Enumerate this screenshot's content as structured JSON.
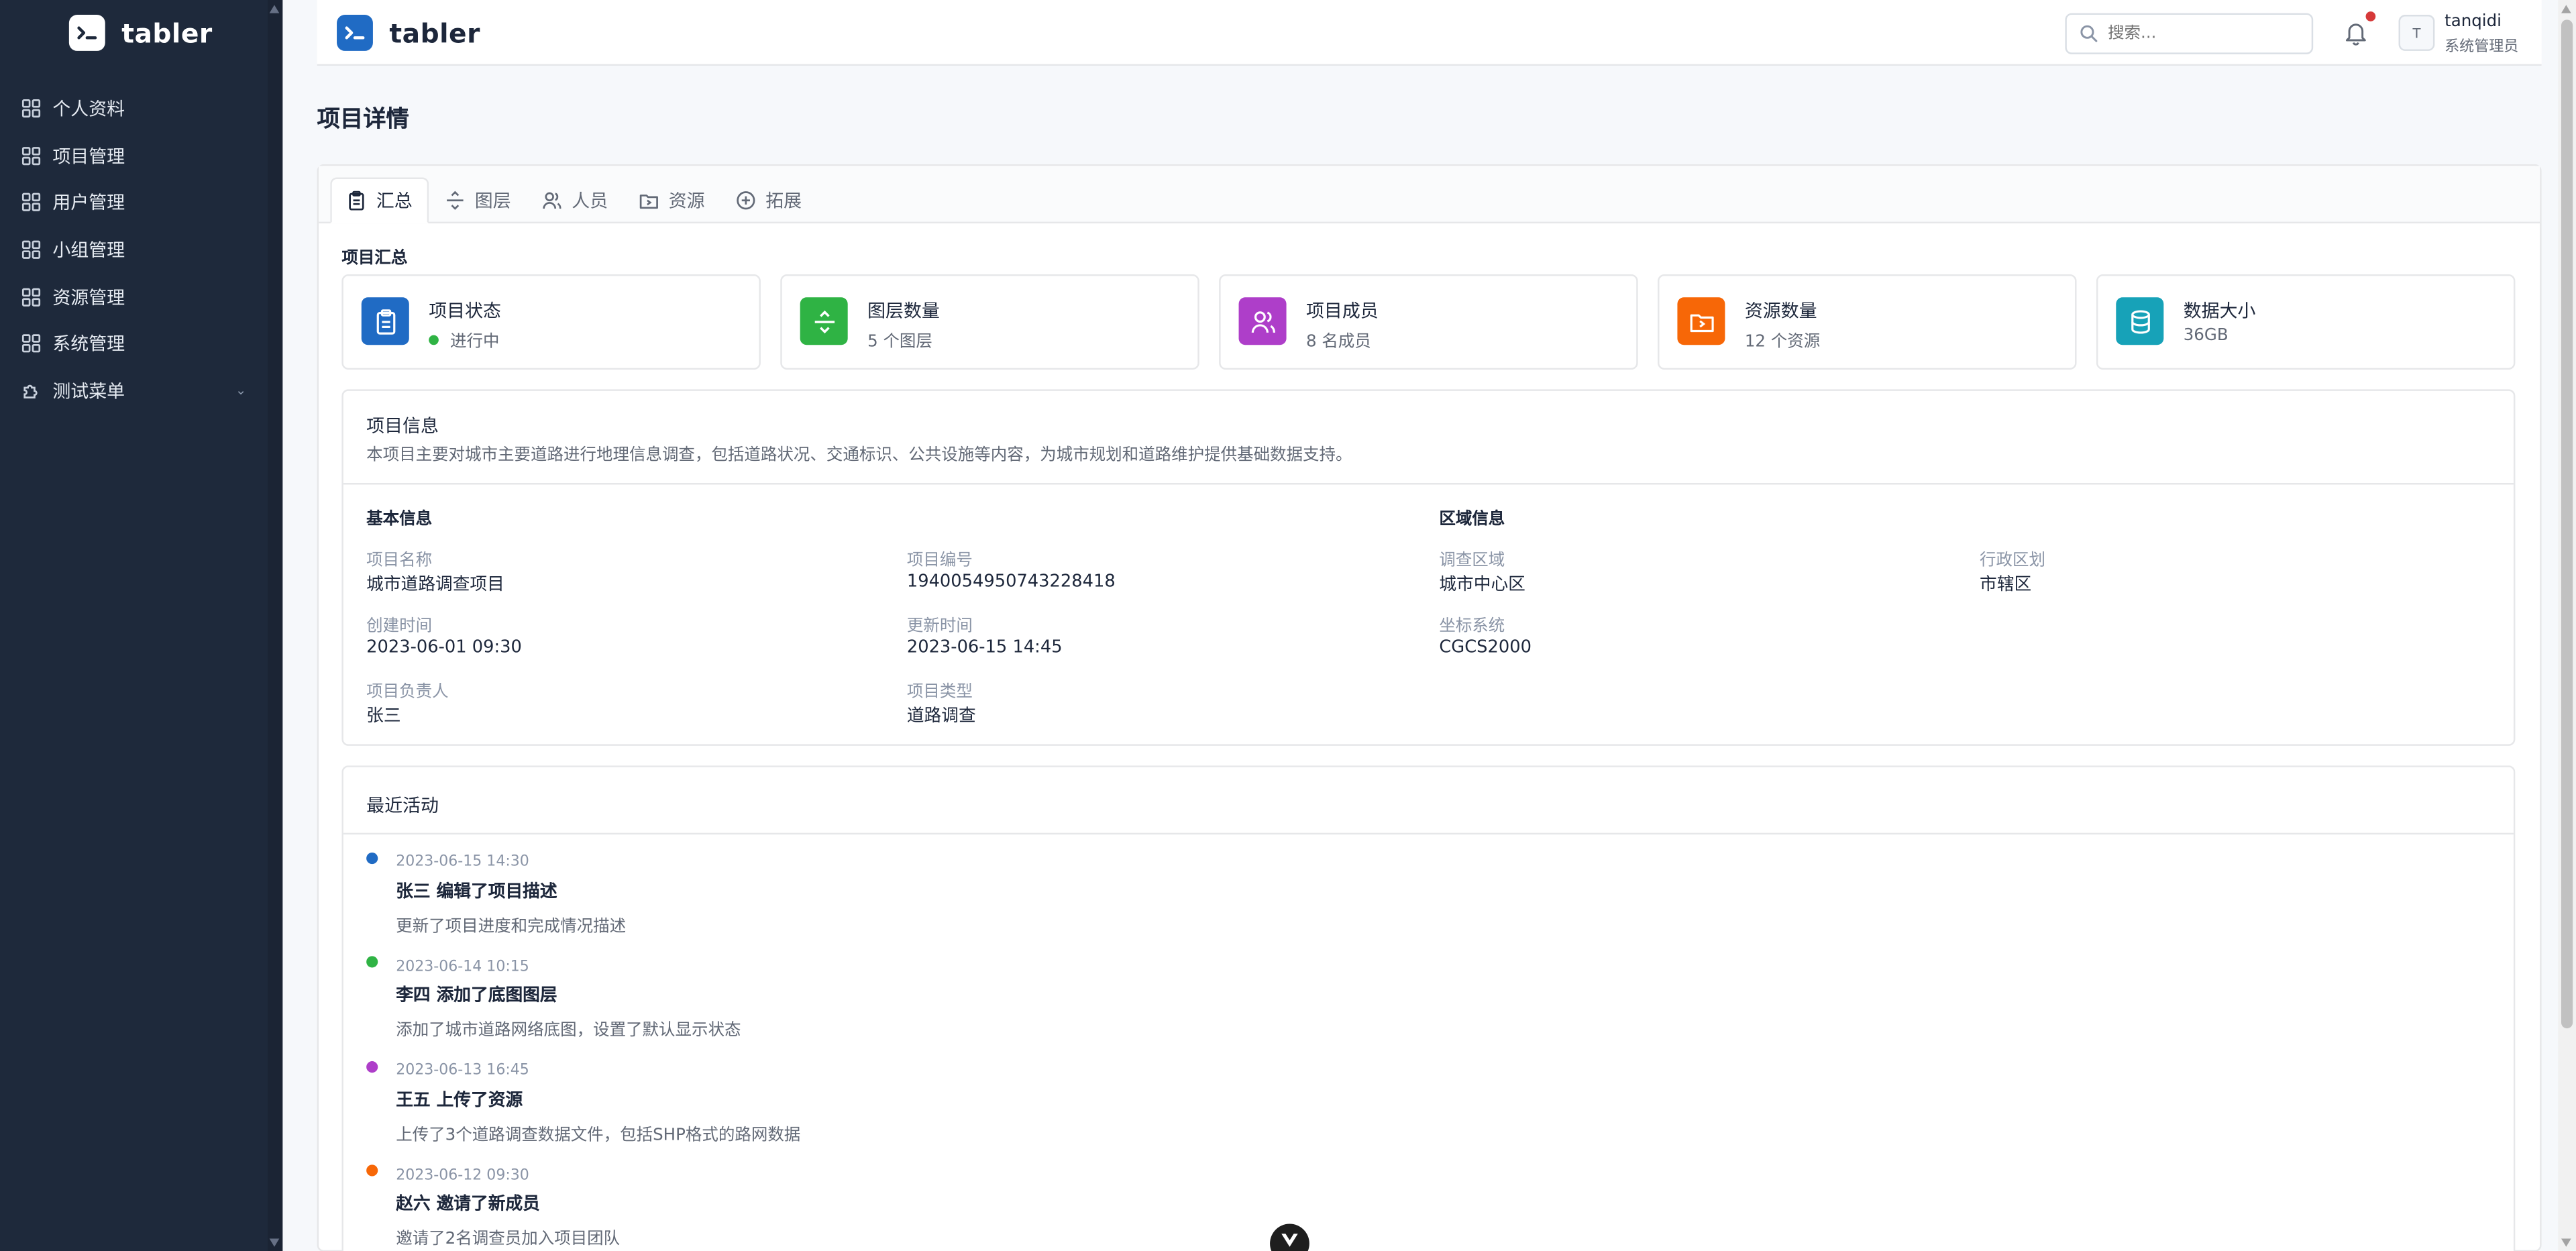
{
  "app": {
    "brand": "tabler"
  },
  "sidebar": {
    "items": [
      {
        "label": "个人资料"
      },
      {
        "label": "项目管理"
      },
      {
        "label": "用户管理"
      },
      {
        "label": "小组管理"
      },
      {
        "label": "资源管理"
      },
      {
        "label": "系统管理"
      },
      {
        "label": "测试菜单"
      }
    ]
  },
  "header": {
    "search_placeholder": "搜索...",
    "avatar_initial": "T",
    "user_name": "tanqidi",
    "user_role": "系统管理员"
  },
  "page": {
    "title": "项目详情"
  },
  "tabs": [
    {
      "label": "汇总",
      "active": true
    },
    {
      "label": "图层"
    },
    {
      "label": "人员"
    },
    {
      "label": "资源"
    },
    {
      "label": "拓展"
    }
  ],
  "summary": {
    "title": "项目汇总",
    "stats": [
      {
        "label": "项目状态",
        "value": "进行中",
        "color": "#206bc4"
      },
      {
        "label": "图层数量",
        "value": "5 个图层",
        "color": "#2fb344"
      },
      {
        "label": "项目成员",
        "value": "8 名成员",
        "color": "#ae3ec9"
      },
      {
        "label": "资源数量",
        "value": "12 个资源",
        "color": "#f76707"
      },
      {
        "label": "数据大小",
        "value": "36GB",
        "color": "#17a2b8"
      }
    ]
  },
  "info": {
    "title": "项目信息",
    "description": "本项目主要对城市主要道路进行地理信息调查，包括道路状况、交通标识、公共设施等内容，为城市规划和道路维护提供基础数据支持。",
    "basic": {
      "title": "基本信息",
      "fields": [
        {
          "label": "项目名称",
          "value": "城市道路调查项目"
        },
        {
          "label": "项目编号",
          "value": "1940054950743228418"
        },
        {
          "label": "创建时间",
          "value": "2023-06-01 09:30"
        },
        {
          "label": "更新时间",
          "value": "2023-06-15 14:45"
        },
        {
          "label": "项目负责人",
          "value": "张三"
        },
        {
          "label": "项目类型",
          "value": "道路调查"
        }
      ]
    },
    "region": {
      "title": "区域信息",
      "fields": [
        {
          "label": "调查区域",
          "value": "城市中心区"
        },
        {
          "label": "行政区划",
          "value": "市辖区"
        },
        {
          "label": "坐标系统",
          "value": "CGCS2000"
        }
      ]
    }
  },
  "activity": {
    "title": "最近活动",
    "items": [
      {
        "time": "2023-06-15 14:30",
        "title": "张三 编辑了项目描述",
        "desc": "更新了项目进度和完成情况描述",
        "color": "#206bc4"
      },
      {
        "time": "2023-06-14 10:15",
        "title": "李四 添加了底图图层",
        "desc": "添加了城市道路网络底图，设置了默认显示状态",
        "color": "#2fb344"
      },
      {
        "time": "2023-06-13 16:45",
        "title": "王五 上传了资源",
        "desc": "上传了3个道路调查数据文件，包括SHP格式的路网数据",
        "color": "#ae3ec9"
      },
      {
        "time": "2023-06-12 09:30",
        "title": "赵六 邀请了新成员",
        "desc": "邀请了2名调查员加入项目团队",
        "color": "#f76707"
      }
    ]
  }
}
